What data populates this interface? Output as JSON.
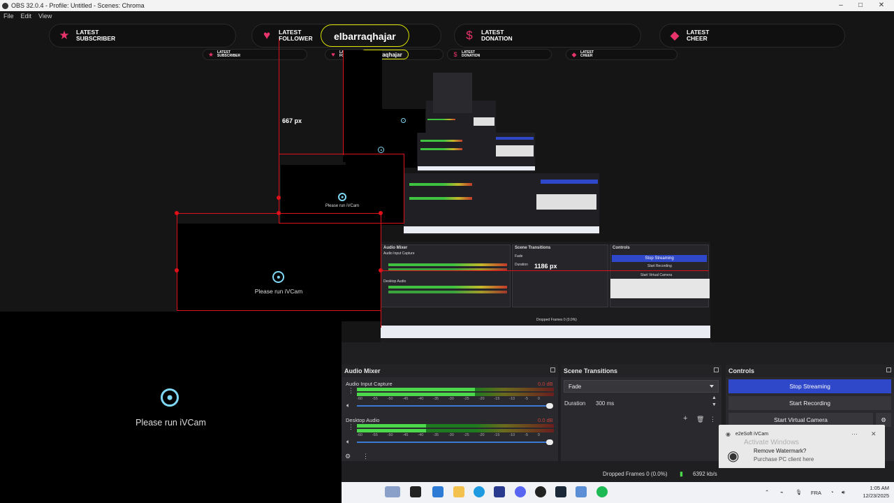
{
  "window": {
    "title": "OBS 32.0.4 - Profile: Untitled - Scenes: Chroma",
    "controls": [
      "–",
      "□",
      "✕"
    ]
  },
  "menu": [
    "File",
    "Edit",
    "View"
  ],
  "overlay": {
    "items": [
      {
        "label": "LATEST SUBSCRIBER",
        "icon": "star-icon",
        "value": ""
      },
      {
        "label": "LATEST FOLLOWER",
        "icon": "heart-icon",
        "value": "elbarraqhajar"
      },
      {
        "label": "LATEST DONATION",
        "icon": "dollar-icon",
        "value": ""
      },
      {
        "label": "LATEST CHEER",
        "icon": "gem-icon",
        "value": ""
      }
    ],
    "accent": "#e8336b"
  },
  "preview": {
    "cam_text": "Please run iVCam",
    "measure_h": "667 px",
    "measure_w": "1186 px",
    "selection_color": "#e0101a",
    "mini_labels": {
      "audio_mixer": "Audio Mixer",
      "scene_transitions": "Scene Transitions",
      "controls": "Controls",
      "audio_input": "Audio Input Capture",
      "desktop_audio": "Desktop Audio",
      "fade": "Fade",
      "duration": "Duration",
      "stop_streaming": "Stop Streaming",
      "start_recording": "Start Recording",
      "start_virtual": "Start Virtual Camera",
      "dropped": "Dropped Frames 0 (0.0%)"
    }
  },
  "audio_mixer": {
    "title": "Audio Mixer",
    "channels": [
      {
        "name": "Audio Input Capture",
        "db": "0.0 dB",
        "level": 0.6
      },
      {
        "name": "Desktop Audio",
        "db": "0.0 dB",
        "level": 0.35
      }
    ],
    "scale": [
      "-60",
      "-55",
      "-50",
      "-45",
      "-40",
      "-35",
      "-30",
      "-25",
      "-20",
      "-15",
      "-10",
      "-5",
      "0"
    ]
  },
  "scene_transitions": {
    "title": "Scene Transitions",
    "transition": "Fade",
    "duration_label": "Duration",
    "duration_value": "300 ms"
  },
  "controls": {
    "title": "Controls",
    "stop_streaming": "Stop Streaming",
    "start_recording": "Start Recording",
    "start_virtual_camera": "Start Virtual Camera",
    "accent": "#2f47c9"
  },
  "notification": {
    "app": "e2eSoft iVCam",
    "watermark": "Activate Windows",
    "line1": "Remove Watermark?",
    "line2": "Purchase PC client here"
  },
  "status": {
    "dropped": "Dropped Frames 0 (0.0%)",
    "bitrate": "6392 kb/s"
  },
  "tray": {
    "lang": "FRA",
    "time": "1:05 AM",
    "date": "12/23/2025"
  }
}
